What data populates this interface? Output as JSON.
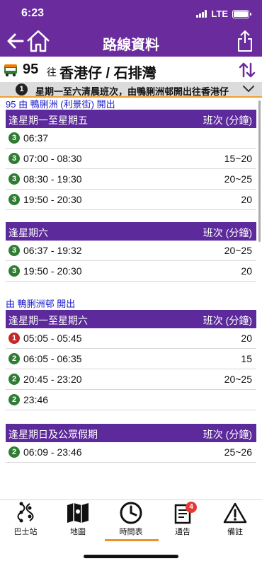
{
  "status": {
    "time": "6:23",
    "network": "LTE"
  },
  "nav": {
    "title": "路線資料"
  },
  "route": {
    "number": "95",
    "to": "往",
    "destination": "香港仔 / 石排灣"
  },
  "notice": {
    "number": "1",
    "text": "星期一至六清晨班次，由鴨脷洲邨開出往香港仔"
  },
  "sections": [
    {
      "heading": "95 由 鴨脷洲 (利景街) 開出",
      "tables": [
        {
          "title": "逢星期一至星期五",
          "col_label": "班次 (分鐘)",
          "rows": [
            {
              "badge": "3",
              "badge_color": "green",
              "time": "06:37",
              "freq": ""
            },
            {
              "badge": "3",
              "badge_color": "green",
              "time": "07:00 - 08:30",
              "freq": "15~20"
            },
            {
              "badge": "3",
              "badge_color": "green",
              "time": "08:30 - 19:30",
              "freq": "20~25"
            },
            {
              "badge": "3",
              "badge_color": "green",
              "time": "19:50 - 20:30",
              "freq": "20"
            }
          ]
        },
        {
          "title": "逢星期六",
          "col_label": "班次 (分鐘)",
          "rows": [
            {
              "badge": "3",
              "badge_color": "green",
              "time": "06:37 - 19:32",
              "freq": "20~25"
            },
            {
              "badge": "3",
              "badge_color": "green",
              "time": "19:50 - 20:30",
              "freq": "20"
            }
          ]
        }
      ]
    },
    {
      "heading": "由 鴨脷洲邨 開出",
      "tables": [
        {
          "title": "逢星期一至星期六",
          "col_label": "班次 (分鐘)",
          "rows": [
            {
              "badge": "1",
              "badge_color": "red",
              "time": "05:05 - 05:45",
              "freq": "20"
            },
            {
              "badge": "2",
              "badge_color": "green",
              "time": "06:05 - 06:35",
              "freq": "15"
            },
            {
              "badge": "2",
              "badge_color": "green",
              "time": "20:45 - 23:20",
              "freq": "20~25"
            },
            {
              "badge": "2",
              "badge_color": "green",
              "time": "23:46",
              "freq": ""
            }
          ]
        },
        {
          "title": "逢星期日及公眾假期",
          "col_label": "班次 (分鐘)",
          "rows": [
            {
              "badge": "2",
              "badge_color": "green",
              "time": "06:09 - 23:46",
              "freq": "25~26"
            }
          ]
        }
      ]
    }
  ],
  "tabs": [
    {
      "label": "巴士站",
      "icon": "bus-stop-icon"
    },
    {
      "label": "地圖",
      "icon": "map-icon"
    },
    {
      "label": "時間表",
      "icon": "clock-icon",
      "active": true
    },
    {
      "label": "通告",
      "icon": "notice-icon",
      "badge": "4"
    },
    {
      "label": "備註",
      "icon": "warning-icon"
    }
  ],
  "colors": {
    "header": "#6a2c9c",
    "table_header": "#5c2a9a",
    "section_text": "#1a1ac8",
    "badge_green": "#2e7d32",
    "badge_red": "#c62828",
    "tab_accent": "#e8942c"
  }
}
